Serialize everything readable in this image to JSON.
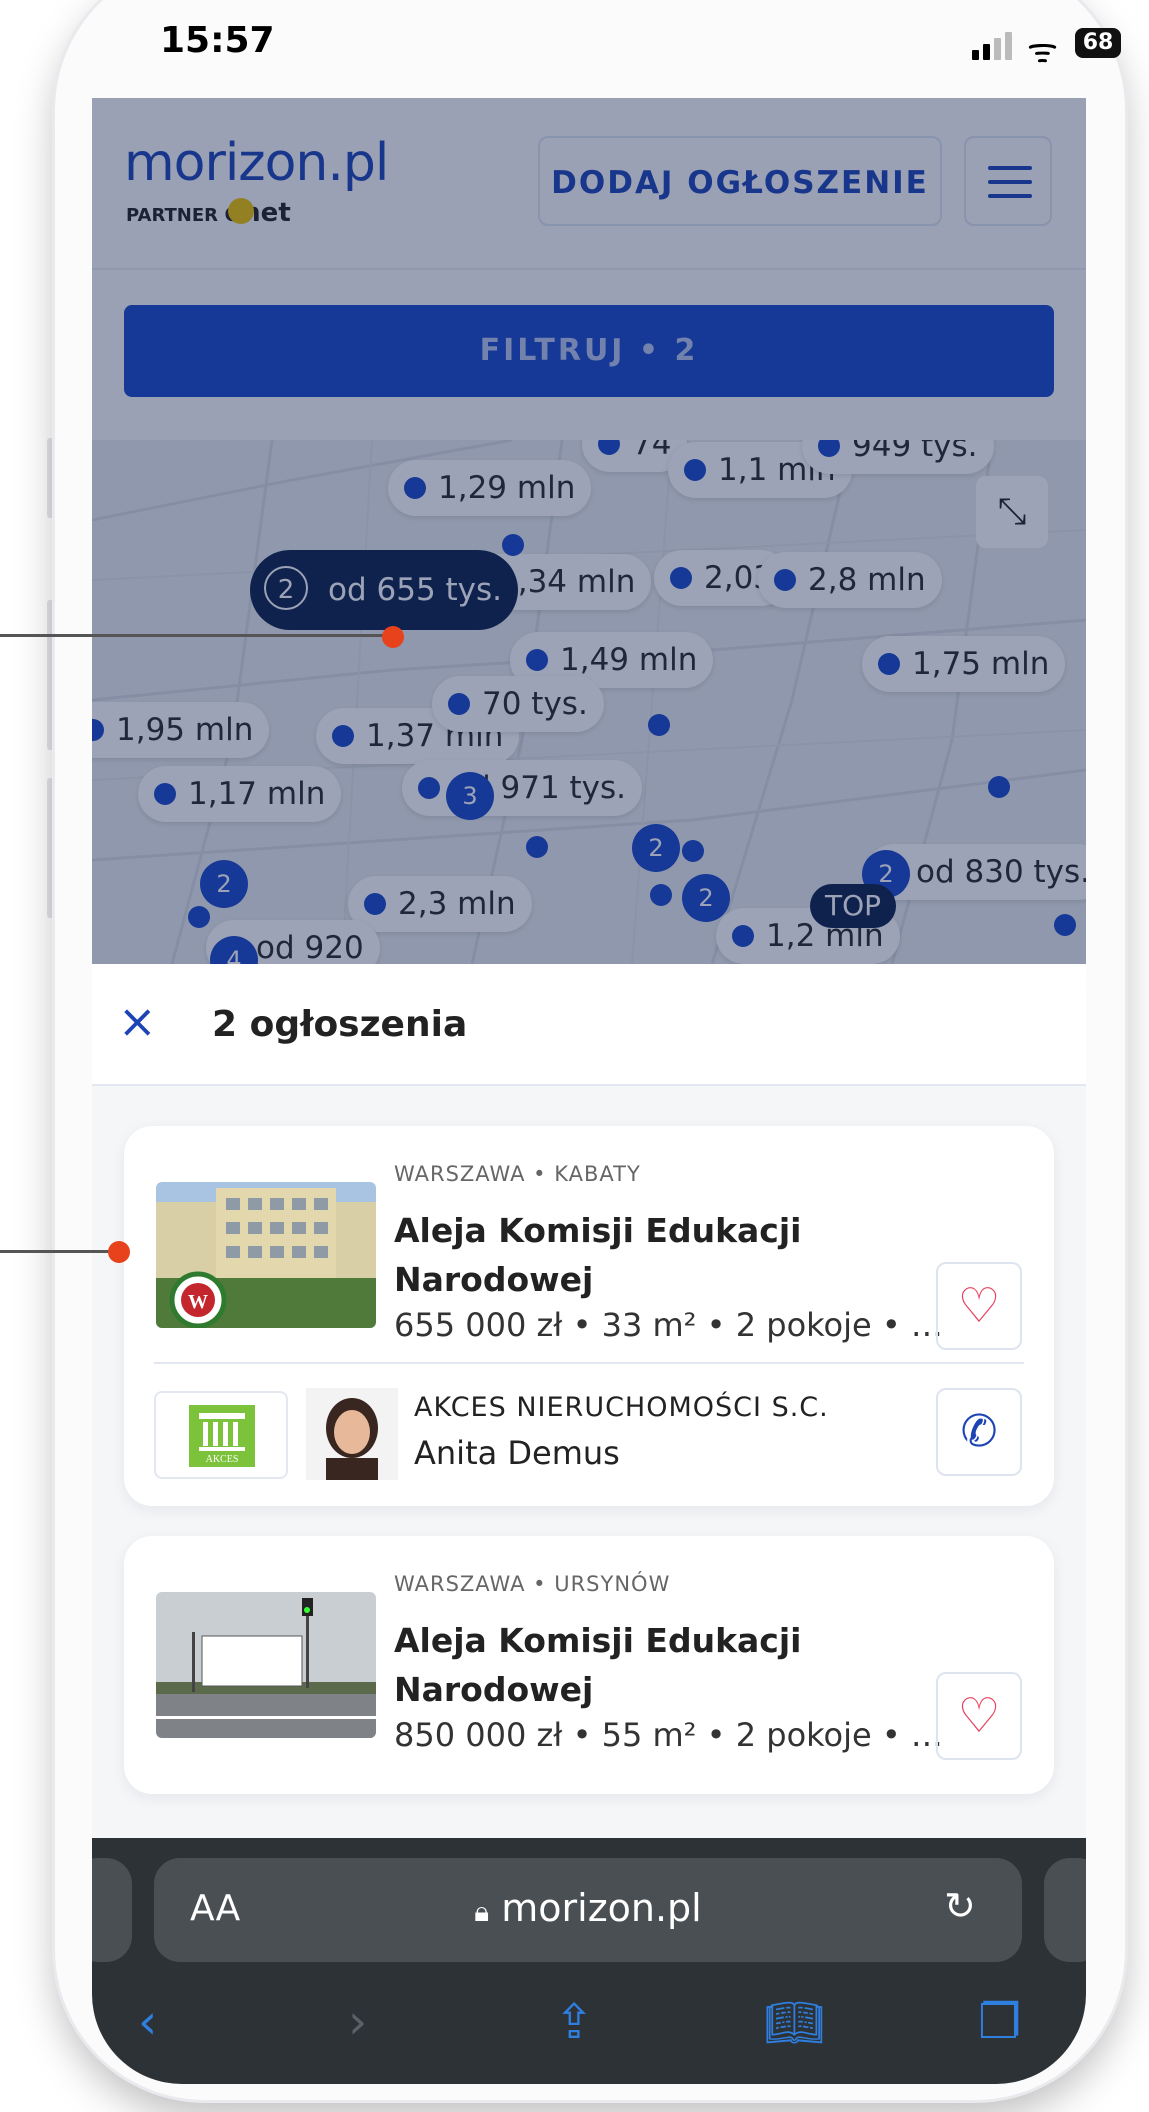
{
  "status_bar": {
    "time": "15:57",
    "battery": "68"
  },
  "header": {
    "logo": "morizon.pl",
    "partner_label": "PARTNER",
    "partner_brand": "onet",
    "add_button": "DODAJ OGŁOSZENIE"
  },
  "filter": {
    "label": "FILTRUJ • 2"
  },
  "map": {
    "selected_pin": {
      "count": "2",
      "label": "od 655 tys."
    },
    "pins": [
      "74",
      "1,1 mln",
      "949 tys.",
      "1,29 mln",
      "1,34 mln",
      "2,03",
      "2,8 mln",
      "1,49 mln",
      "1,75 mln",
      "1,95 mln",
      "1,37 mln",
      "70 tys.",
      "od 971 tys.",
      "1,17 mln",
      "od 830 tys.",
      "2,3 mln",
      "od 920",
      "1,2 mln"
    ],
    "cluster_counts": [
      "3",
      "2",
      "2",
      "2",
      "2",
      "4"
    ],
    "top_badge": "TOP"
  },
  "sheet": {
    "close_icon": "×",
    "title": "2 ogłoszenia"
  },
  "listings": [
    {
      "location": "WARSZAWA • KABATY",
      "title": "Aleja Komisji Edukacji Narodowej",
      "meta": "655 000 zł • 33 m² • 2 pokoje • …",
      "agency": "AKCES NIERUCHOMOŚCI S.C.",
      "agent": "Anita Demus",
      "agency_logo_text": "AKCES"
    },
    {
      "location": "WARSZAWA • URSYNÓW",
      "title": "Aleja Komisji Edukacji Narodowej",
      "meta": "850 000 zł • 55 m² • 2 pokoje • …"
    }
  ],
  "browser": {
    "aa": "AA",
    "url": "morizon.pl"
  },
  "colors": {
    "brand_blue": "#1947c9",
    "heart": "#e8405c",
    "annotation_red": "#e8421c"
  }
}
